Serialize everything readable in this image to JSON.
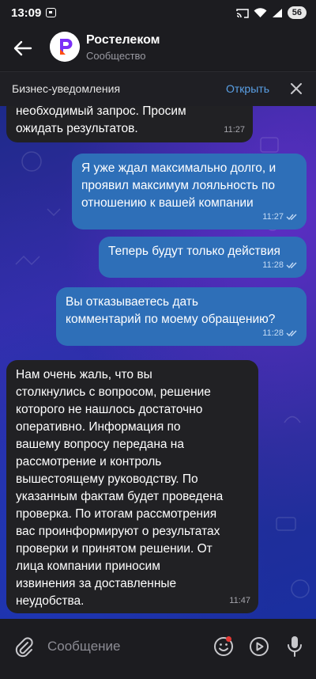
{
  "status_bar": {
    "time": "13:09",
    "battery": "56"
  },
  "header": {
    "title": "Ростелеком",
    "subtitle": "Сообщество"
  },
  "notification_bar": {
    "label": "Бизнес-уведомления",
    "open_label": "Открыть"
  },
  "messages": [
    {
      "direction": "in",
      "text": "необходимый запрос. Просим\nожидать результатов.",
      "time": "11:27"
    },
    {
      "direction": "out",
      "text": "Я уже ждал максимально долго, и\nпроявил максимум лояльность по\nотношению к вашей компании",
      "time": "11:27",
      "read": true
    },
    {
      "direction": "out",
      "text": "Теперь будут только действия",
      "time": "11:28",
      "read": true
    },
    {
      "direction": "out",
      "text": "Вы отказываетесь дать\nкомментарий по моему обращению?",
      "time": "11:28",
      "read": true
    },
    {
      "direction": "in",
      "text": "Нам очень жаль, что вы\nстолкнулись с вопросом, решение\nкоторого не нашлось достаточно\nоперативно. Информация по\nвашему вопросу передана на\nрассмотрение и контроль\nвышестоящему руководству. По\nуказанным фактам будет проведена\nпроверка. По итогам рассмотрения\nвас проинформируют о результатах\nпроверки и принятом решении. От\nлица компании приносим\nизвинения за доставленные\nнеудобства.",
      "time": "11:47"
    }
  ],
  "input_bar": {
    "placeholder": "Сообщение"
  },
  "colors": {
    "outgoing_bubble": "#2e6fb8",
    "incoming_bubble": "#212124",
    "accent": "#5aa0e6",
    "brand": "#7b2ff7"
  },
  "icons": [
    "back-arrow-icon",
    "close-icon",
    "attach-icon",
    "emoji-icon",
    "play-icon",
    "mic-icon",
    "double-check-icon",
    "cast-icon",
    "wifi-icon",
    "signal-icon"
  ]
}
